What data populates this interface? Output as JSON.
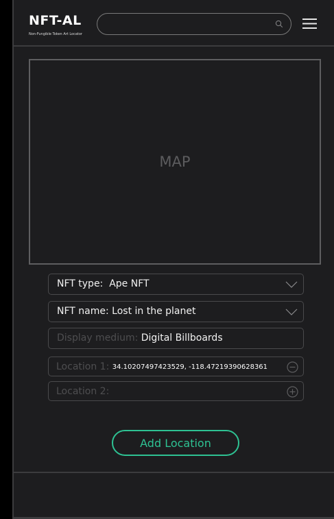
{
  "header": {
    "logo_title": "NFT-AL",
    "logo_subtitle": "Non-Fungible Token Art Locator",
    "search_placeholder": "",
    "search_icon": "search-icon",
    "menu_icon": "hamburger-menu-icon"
  },
  "map": {
    "label": "MAP"
  },
  "form": {
    "nft_type": {
      "label": "NFT type:",
      "value": "Ape NFT"
    },
    "nft_name": {
      "label": "NFT name:",
      "value": "Lost in the planet"
    },
    "display_medium": {
      "label": "Display medium:",
      "value": "Digital Billboards"
    },
    "locations": [
      {
        "label": "Location 1:",
        "value": "34.10207497423529, -118.47219390628361",
        "action_icon": "minus-circle-icon"
      },
      {
        "label": "Location 2:",
        "value": "",
        "action_icon": "plus-circle-icon"
      }
    ],
    "add_location_label": "Add Location"
  },
  "colors": {
    "background": "#1d1d1f",
    "border": "#3c3c3e",
    "accent": "#2ec293",
    "placeholder": "#4e4e50"
  }
}
